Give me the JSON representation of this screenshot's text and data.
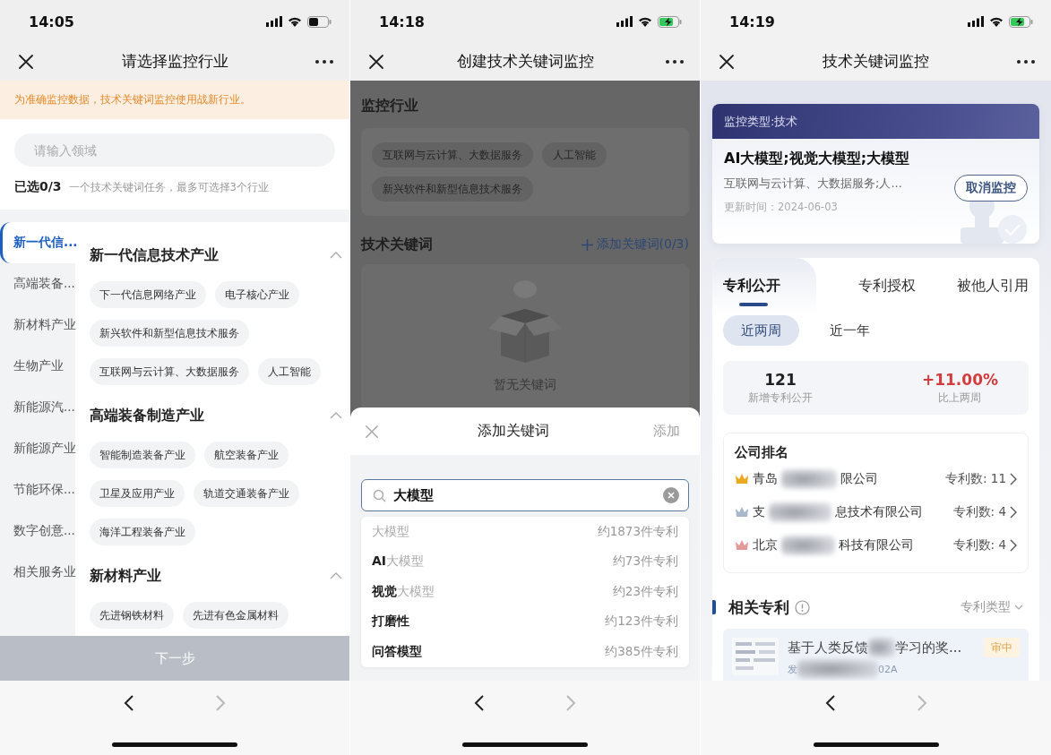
{
  "screen_1": {
    "status_bar": {
      "time": "14:05",
      "charging": false
    },
    "nav": {
      "title": "请选择监控行业"
    },
    "notice": "为准确监控数据，技术关键词监控使用战新行业。",
    "search": {
      "placeholder": "请输入领域"
    },
    "selection": {
      "count": "已选0/3",
      "hint": "一个技术关键词任务，最多可选择3个行业"
    },
    "categories": [
      {
        "label": "新一代信...",
        "selected": true
      },
      {
        "label": "高端装备...",
        "selected": false
      },
      {
        "label": "新材料产业",
        "selected": false
      },
      {
        "label": "生物产业",
        "selected": false
      },
      {
        "label": "新能源汽...",
        "selected": false
      },
      {
        "label": "新能源产业",
        "selected": false
      },
      {
        "label": "节能环保...",
        "selected": false
      },
      {
        "label": "数字创意...",
        "selected": false
      },
      {
        "label": "相关服务业",
        "selected": false
      }
    ],
    "sections": [
      {
        "title": "新一代信息技术产业",
        "expanded": true,
        "tags": [
          "下一代信息网络产业",
          "电子核心产业",
          "新兴软件和新型信息技术服务",
          "互联网与云计算、大数据服务",
          "人工智能"
        ]
      },
      {
        "title": "高端装备制造产业",
        "expanded": true,
        "tags": [
          "智能制造装备产业",
          "航空装备产业",
          "卫星及应用产业",
          "轨道交通装备产业",
          "海洋工程装备产业"
        ]
      },
      {
        "title": "新材料产业",
        "expanded": true,
        "tags": [
          "先进钢铁材料",
          "先进有色金属材料"
        ]
      }
    ],
    "next_button": {
      "label": "下一步",
      "disabled": true
    },
    "browser_bar": {
      "back_disabled": false,
      "forward_disabled": true
    }
  },
  "screen_2": {
    "status_bar": {
      "time": "14:18",
      "charging": true
    },
    "nav": {
      "title": "创建技术关键词监控"
    },
    "industry_heading": "监控行业",
    "industries": [
      "互联网与云计算、大数据服务",
      "人工智能",
      "新兴软件和新型信息技术服务"
    ],
    "keyword_heading": "技术关键词",
    "add_link": "添加关键词(0/3)",
    "empty_text": "暂无关键词",
    "sheet": {
      "title": "添加关键词",
      "action": "添加",
      "action_disabled": true,
      "search_value": "大模型",
      "suggestions": [
        {
          "match": "大模型",
          "count": "约1873件专利"
        },
        {
          "prefix": "AI",
          "match": "大模型",
          "count": "约73件专利"
        },
        {
          "prefix": "视觉",
          "match": "大模型",
          "count": "约23件专利"
        },
        {
          "prefix": "打磨性",
          "count": "约123件专利"
        },
        {
          "prefix": "问答模型",
          "count": "约385件专利"
        }
      ]
    },
    "browser_bar": {
      "back_disabled": false,
      "forward_disabled": true
    }
  },
  "screen_3": {
    "status_bar": {
      "time": "14:19",
      "charging": true
    },
    "nav": {
      "title": "技术关键词监控"
    },
    "monitor_card": {
      "type_label": "监控类型:技术",
      "keywords": "AI大模型;视觉大模型;大模型",
      "industries": "互联网与云计算、大数据服务;人...",
      "updated": "更新时间：2024-06-03",
      "button": "取消监控"
    },
    "tabs": [
      {
        "label": "专利公开",
        "selected": true
      },
      {
        "label": "专利授权",
        "selected": false
      },
      {
        "label": "被他人引用",
        "selected": false
      }
    ],
    "periods": [
      {
        "label": "近两周",
        "selected": true
      },
      {
        "label": "近一年",
        "selected": false
      }
    ],
    "stats": [
      {
        "kind": "count",
        "value": "121",
        "label": "新增专利公开"
      },
      {
        "kind": "change",
        "value": "+11.00%",
        "label": "比上两周"
      }
    ],
    "ranking": {
      "title": "公司排名",
      "rows": [
        {
          "name_start": "青岛",
          "name_end": "限公司",
          "count": "专利数: 11",
          "color": "#e8a820"
        },
        {
          "name_start": "支",
          "name_end": "息技术有限公司",
          "count": "专利数: 4",
          "color": "#a8b8ca"
        },
        {
          "name_start": "北京",
          "name_end": "科技有限公司",
          "count": "专利数: 4",
          "color": "#e49a9a"
        }
      ]
    },
    "related": {
      "title": "相关专利",
      "filter": "专利类型",
      "patent": {
        "title_start": "基于人类反馈",
        "title_end": "学习的奖...",
        "status": "审中",
        "number_start": "发",
        "number_end": "02A"
      }
    },
    "browser_bar": {
      "back_disabled": false,
      "forward_disabled": true
    }
  }
}
